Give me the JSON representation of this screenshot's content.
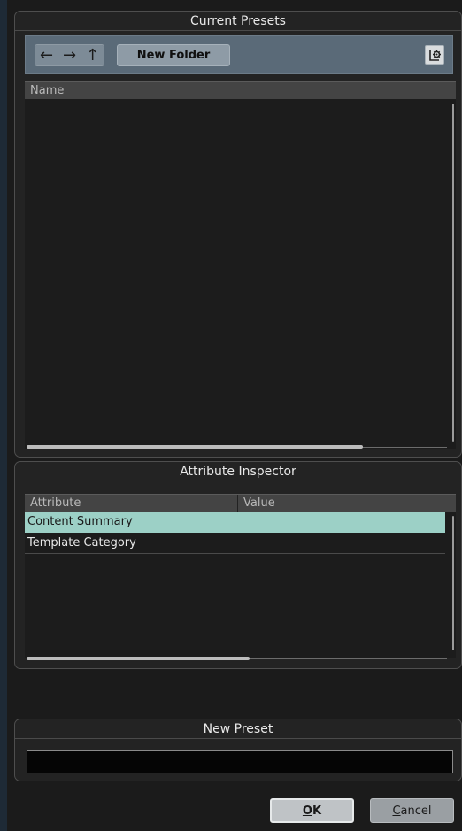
{
  "current_presets": {
    "title": "Current Presets",
    "nav": {
      "back_icon": "←",
      "forward_icon": "→",
      "up_icon": "↑"
    },
    "new_folder_label": "New Folder",
    "list_header": "Name",
    "horizontal_scroll_position": 0.8
  },
  "attribute_inspector": {
    "title": "Attribute Inspector",
    "columns": [
      "Attribute",
      "Value"
    ],
    "rows": [
      {
        "attribute": "Content Summary",
        "value": "",
        "selected": true
      },
      {
        "attribute": "Template Category",
        "value": "",
        "selected": false
      }
    ],
    "horizontal_scroll_position": 0.53
  },
  "new_preset": {
    "title": "New Preset",
    "input_value": ""
  },
  "buttons": {
    "ok_mnemonic": "O",
    "ok_rest": "K",
    "cancel_mnemonic": "C",
    "cancel_rest": "ancel"
  },
  "colors": {
    "selection": "#9cd0c6",
    "toolbar": "#5a6a78"
  }
}
